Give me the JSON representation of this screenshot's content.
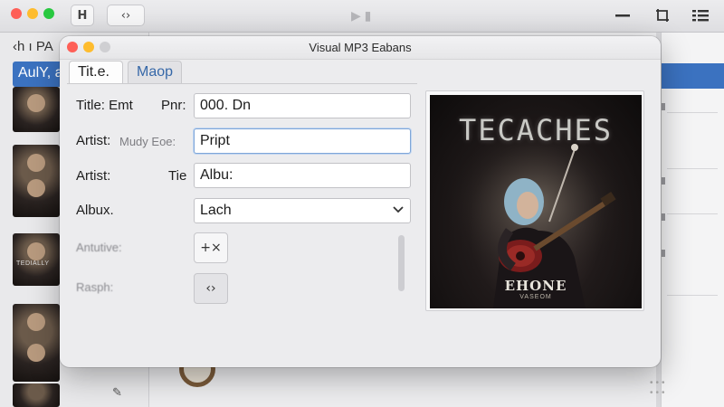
{
  "background": {
    "breadcrumb": "‹h ı PA",
    "sidebar_selected": "AulY, a",
    "thumb_caption": "TEDIALLY",
    "toolbar_left_icon": "H",
    "toolbar_code_icon": "‹›",
    "toolbar_icons": [
      "minimize-icon",
      "crop-icon",
      "list-view-icon"
    ]
  },
  "dialog": {
    "title": "Visual MP3 Eabans",
    "tabs": [
      {
        "label": "Tit.e.",
        "active": true
      },
      {
        "label": "Maop",
        "active": false
      }
    ],
    "rows": [
      {
        "label": "Title: Emt",
        "sublabel": "Pnr:",
        "value": "000. Dn"
      },
      {
        "label": "Artist:",
        "sublabel": "Mudy Eoe:",
        "value": "Pript"
      },
      {
        "label": "Artist:",
        "sublabel": "Tie",
        "value": "Albu:"
      },
      {
        "label": "Albux.",
        "sublabel": "",
        "value": "Lach"
      },
      {
        "label": "Antutive:",
        "sublabel": "",
        "value": "+×"
      },
      {
        "label": "Rasph:",
        "sublabel": "",
        "value": "‹›"
      }
    ],
    "album_art": {
      "title_text": "TECACHES",
      "subtitle_text": "EHONE",
      "small_text": "VASEOM"
    }
  },
  "colors": {
    "accent_blue": "#3b72c0",
    "tab_link": "#3668a8",
    "close_red": "#fe5f57",
    "minimize_yellow": "#febc2e",
    "zoom_green": "#28c840"
  }
}
